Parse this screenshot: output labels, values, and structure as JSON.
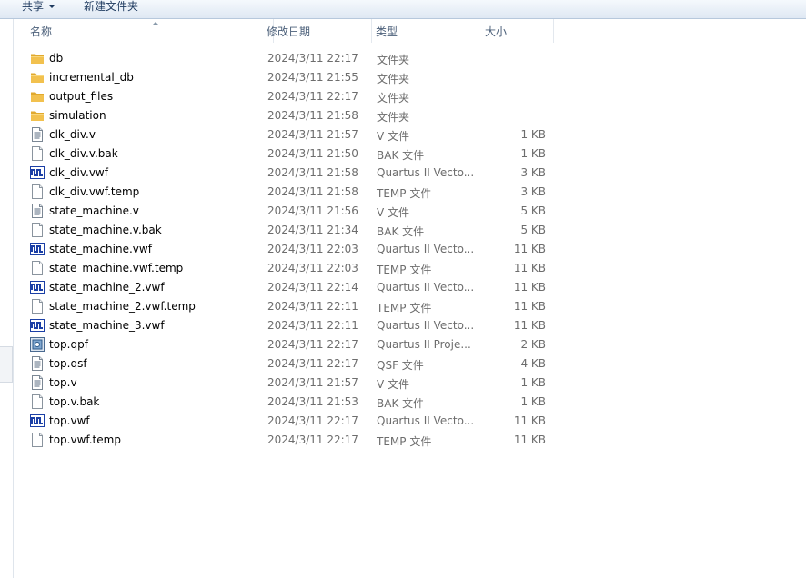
{
  "toolbar": {
    "share_label": "共享",
    "new_folder_label": "新建文件夹"
  },
  "columns": {
    "name": "名称",
    "date": "修改日期",
    "type": "类型",
    "size": "大小"
  },
  "files": [
    {
      "name": "db",
      "date": "2024/3/11 22:17",
      "type": "文件夹",
      "size": "",
      "icon": "folder-icon"
    },
    {
      "name": "incremental_db",
      "date": "2024/3/11 21:55",
      "type": "文件夹",
      "size": "",
      "icon": "folder-icon"
    },
    {
      "name": "output_files",
      "date": "2024/3/11 22:17",
      "type": "文件夹",
      "size": "",
      "icon": "folder-icon"
    },
    {
      "name": "simulation",
      "date": "2024/3/11 21:58",
      "type": "文件夹",
      "size": "",
      "icon": "folder-icon"
    },
    {
      "name": "clk_div.v",
      "date": "2024/3/11 21:57",
      "type": "V 文件",
      "size": "1 KB",
      "icon": "text-file-icon"
    },
    {
      "name": "clk_div.v.bak",
      "date": "2024/3/11 21:50",
      "type": "BAK 文件",
      "size": "1 KB",
      "icon": "blank-file-icon"
    },
    {
      "name": "clk_div.vwf",
      "date": "2024/3/11 21:58",
      "type": "Quartus II Vecto...",
      "size": "3 KB",
      "icon": "waveform-file-icon"
    },
    {
      "name": "clk_div.vwf.temp",
      "date": "2024/3/11 21:58",
      "type": "TEMP 文件",
      "size": "3 KB",
      "icon": "blank-file-icon"
    },
    {
      "name": "state_machine.v",
      "date": "2024/3/11 21:56",
      "type": "V 文件",
      "size": "5 KB",
      "icon": "text-file-icon"
    },
    {
      "name": "state_machine.v.bak",
      "date": "2024/3/11 21:34",
      "type": "BAK 文件",
      "size": "5 KB",
      "icon": "blank-file-icon"
    },
    {
      "name": "state_machine.vwf",
      "date": "2024/3/11 22:03",
      "type": "Quartus II Vecto...",
      "size": "11 KB",
      "icon": "waveform-file-icon"
    },
    {
      "name": "state_machine.vwf.temp",
      "date": "2024/3/11 22:03",
      "type": "TEMP 文件",
      "size": "11 KB",
      "icon": "blank-file-icon"
    },
    {
      "name": "state_machine_2.vwf",
      "date": "2024/3/11 22:14",
      "type": "Quartus II Vecto...",
      "size": "11 KB",
      "icon": "waveform-file-icon"
    },
    {
      "name": "state_machine_2.vwf.temp",
      "date": "2024/3/11 22:11",
      "type": "TEMP 文件",
      "size": "11 KB",
      "icon": "blank-file-icon"
    },
    {
      "name": "state_machine_3.vwf",
      "date": "2024/3/11 22:11",
      "type": "Quartus II Vecto...",
      "size": "11 KB",
      "icon": "waveform-file-icon"
    },
    {
      "name": "top.qpf",
      "date": "2024/3/11 22:17",
      "type": "Quartus II Proje...",
      "size": "2 KB",
      "icon": "project-file-icon"
    },
    {
      "name": "top.qsf",
      "date": "2024/3/11 22:17",
      "type": "QSF 文件",
      "size": "4 KB",
      "icon": "text-file-icon"
    },
    {
      "name": "top.v",
      "date": "2024/3/11 21:57",
      "type": "V 文件",
      "size": "1 KB",
      "icon": "text-file-icon"
    },
    {
      "name": "top.v.bak",
      "date": "2024/3/11 21:53",
      "type": "BAK 文件",
      "size": "1 KB",
      "icon": "blank-file-icon"
    },
    {
      "name": "top.vwf",
      "date": "2024/3/11 22:17",
      "type": "Quartus II Vecto...",
      "size": "11 KB",
      "icon": "waveform-file-icon"
    },
    {
      "name": "top.vwf.temp",
      "date": "2024/3/11 22:17",
      "type": "TEMP 文件",
      "size": "11 KB",
      "icon": "blank-file-icon"
    }
  ],
  "colors": {
    "folder": "#f2c14e",
    "header_text": "#4c607a",
    "waveform": "#1b3fa6"
  }
}
